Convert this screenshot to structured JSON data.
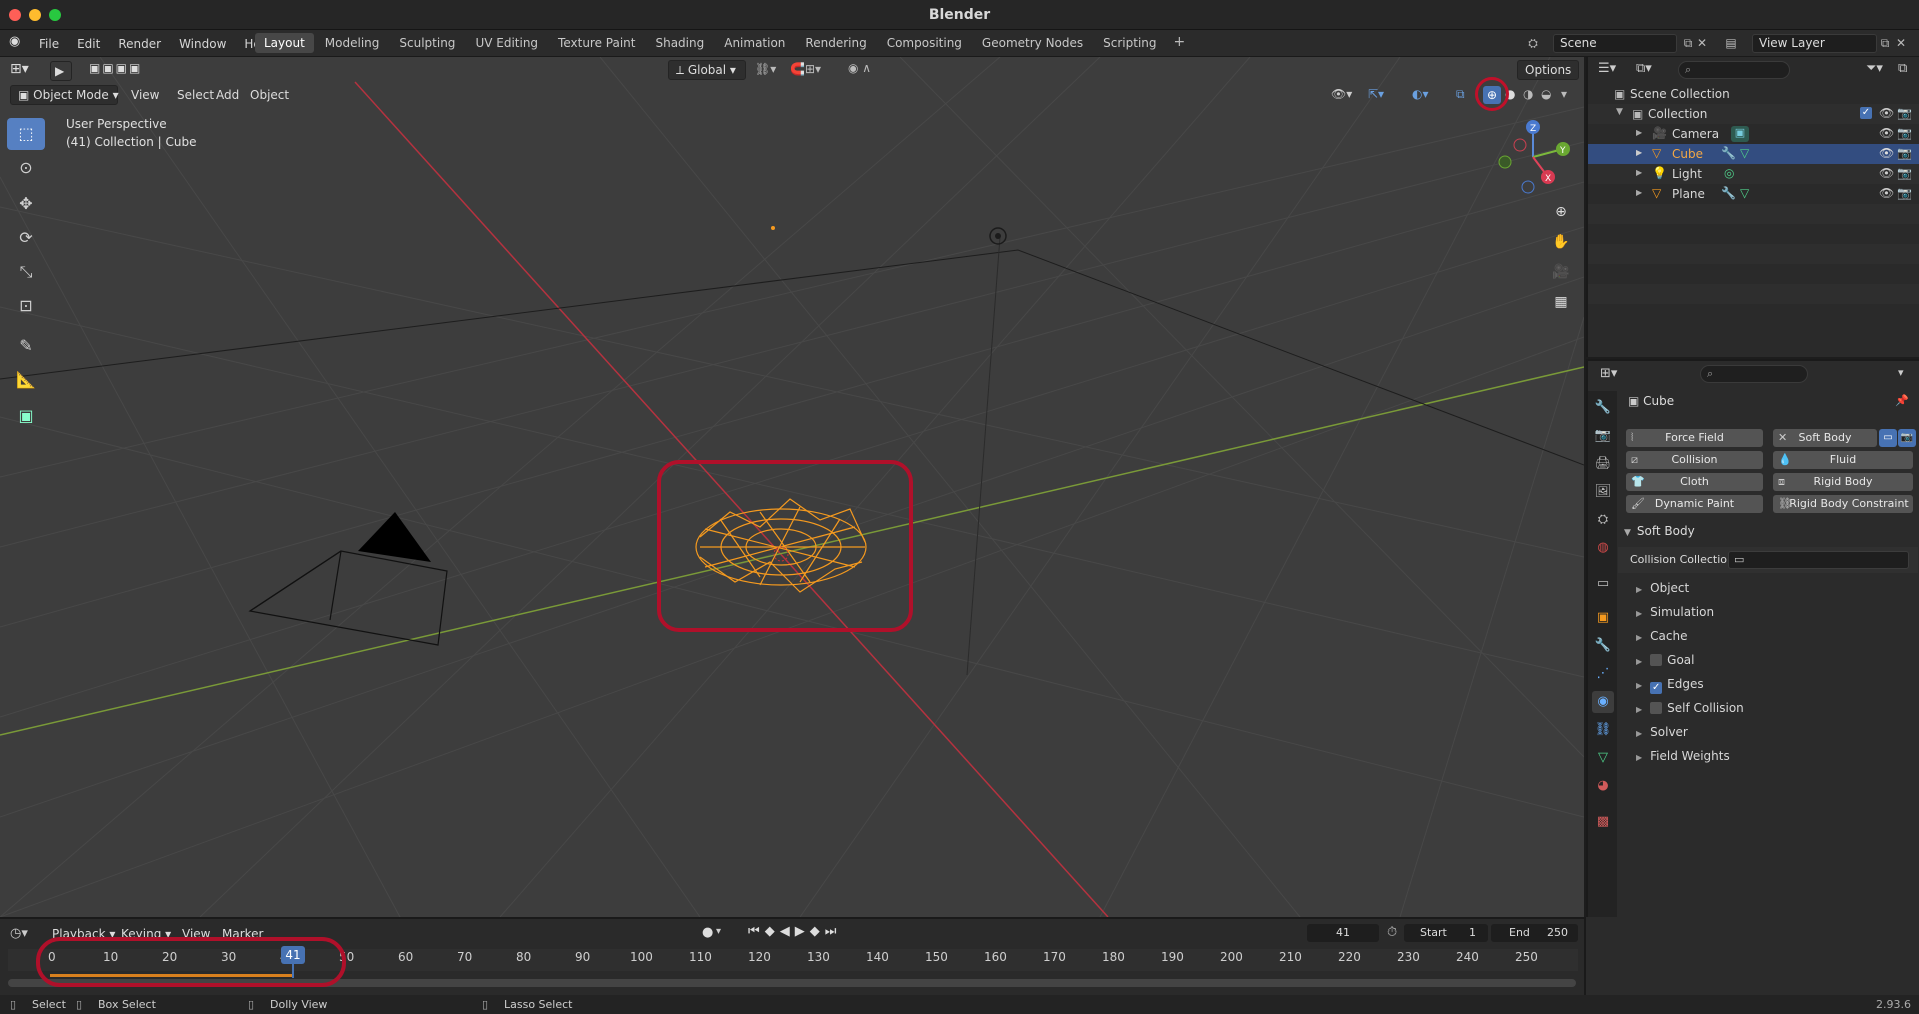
{
  "window": {
    "title": "Blender"
  },
  "menu": [
    "File",
    "Edit",
    "Render",
    "Window",
    "Help"
  ],
  "workspaces": [
    "Layout",
    "Modeling",
    "Sculpting",
    "UV Editing",
    "Texture Paint",
    "Shading",
    "Animation",
    "Rendering",
    "Compositing",
    "Geometry Nodes",
    "Scripting"
  ],
  "active_workspace": "Layout",
  "scene": {
    "name": "Scene",
    "view_layer": "View Layer"
  },
  "viewport": {
    "mode": "Object Mode",
    "menus": [
      "View",
      "Select",
      "Add",
      "Object"
    ],
    "transform_orientation": "Global",
    "options_label": "Options",
    "overlay_title": "User Perspective",
    "overlay_subtitle": "(41) Collection | Cube",
    "axes": {
      "x": "X",
      "y": "Y",
      "z": "Z"
    }
  },
  "outliner": {
    "root": "Scene Collection",
    "collection": "Collection",
    "objects": [
      {
        "name": "Camera",
        "selected": false
      },
      {
        "name": "Cube",
        "selected": true
      },
      {
        "name": "Light",
        "selected": false
      },
      {
        "name": "Plane",
        "selected": false
      }
    ]
  },
  "properties": {
    "object_name": "Cube",
    "physics_buttons": [
      "Force Field",
      "Soft Body",
      "Collision",
      "Fluid",
      "Cloth",
      "Rigid Body",
      "Dynamic Paint",
      "Rigid Body Constraint"
    ],
    "panel_title": "Soft Body",
    "collision_collection_label": "Collision Collection",
    "subpanels": [
      {
        "label": "Object",
        "checkbox": null
      },
      {
        "label": "Simulation",
        "checkbox": null
      },
      {
        "label": "Cache",
        "checkbox": null
      },
      {
        "label": "Goal",
        "checkbox": false
      },
      {
        "label": "Edges",
        "checkbox": true
      },
      {
        "label": "Self Collision",
        "checkbox": false
      },
      {
        "label": "Solver",
        "checkbox": null
      },
      {
        "label": "Field Weights",
        "checkbox": null
      }
    ]
  },
  "timeline": {
    "menus": [
      "Playback",
      "Keying",
      "View",
      "Marker"
    ],
    "current_frame": "41",
    "start_label": "Start",
    "start": "1",
    "end_label": "End",
    "end": "250",
    "ticks": [
      "0",
      "10",
      "20",
      "30",
      "40",
      "50",
      "60",
      "70",
      "80",
      "90",
      "100",
      "110",
      "120",
      "130",
      "140",
      "150",
      "160",
      "170",
      "180",
      "190",
      "200",
      "210",
      "220",
      "230",
      "240",
      "250"
    ],
    "playhead_label": "41"
  },
  "statusbar": {
    "select": "Select",
    "box_select": "Box Select",
    "dolly": "Dolly View",
    "lasso": "Lasso Select",
    "version": "2.93.6"
  },
  "colors": {
    "accent": "#4772b3",
    "selected_object": "#f59a1f",
    "highlight_ring": "#b0102a"
  }
}
